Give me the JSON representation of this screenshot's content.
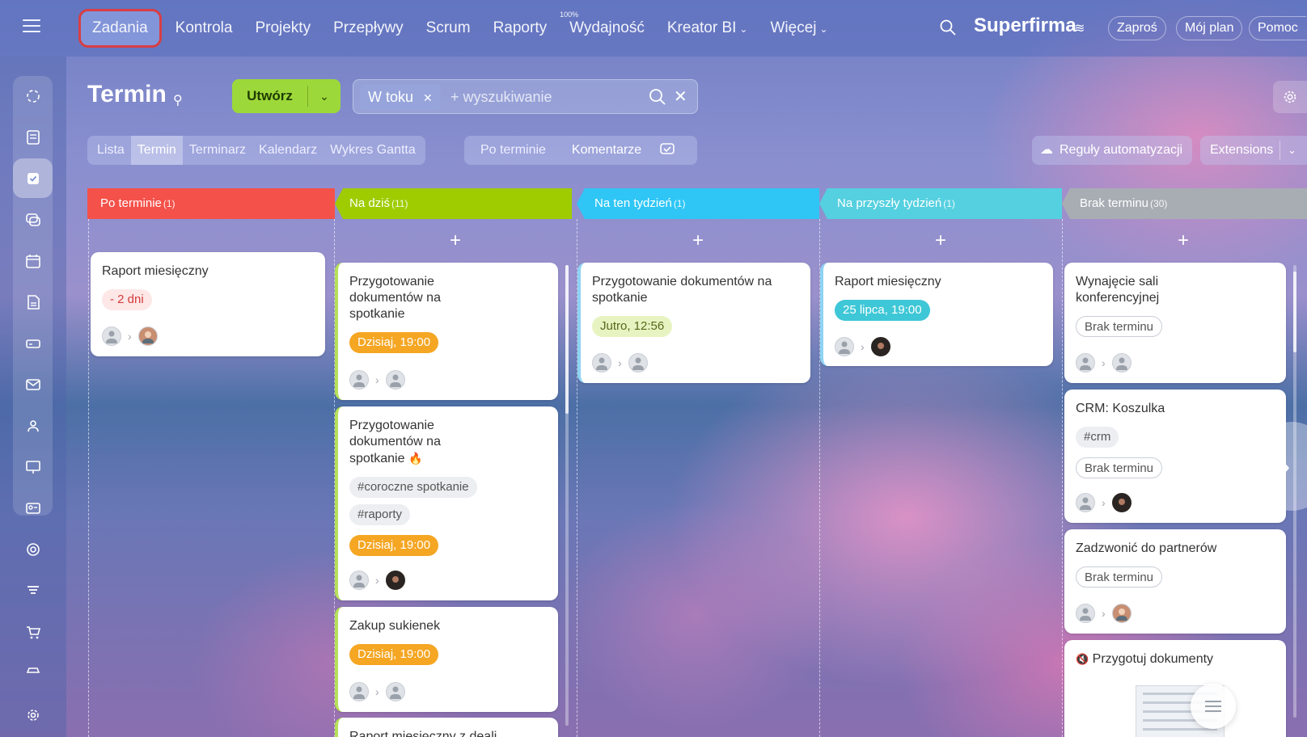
{
  "topbar": {
    "nav": [
      {
        "label": "Zadania",
        "active": true
      },
      {
        "label": "Kontrola"
      },
      {
        "label": "Projekty"
      },
      {
        "label": "Przepływy"
      },
      {
        "label": "Scrum"
      },
      {
        "label": "Raporty"
      },
      {
        "label": "Wydajność",
        "sup": "100%"
      },
      {
        "label": "Kreator BI",
        "dropdown": true
      },
      {
        "label": "Więcej",
        "dropdown": true
      }
    ],
    "brand": "Superfirma",
    "buttons": [
      "Zaproś",
      "Mój plan",
      "Pomoc"
    ]
  },
  "page": {
    "title": "Termin",
    "create_label": "Utwórz",
    "filter_chip": "W toku",
    "search_placeholder": "+ wyszukiwanie"
  },
  "view_tabs": [
    "Lista",
    "Termin",
    "Terminarz",
    "Kalendarz",
    "Wykres Gantta"
  ],
  "active_view": "Termin",
  "filter_tabs": [
    "Po terminie",
    "Komentarze"
  ],
  "automation_label": "Reguły automatyzacji",
  "extensions_label": "Extensions",
  "columns": [
    {
      "title": "Po terminie",
      "count": "(1)",
      "color": "#f4514a"
    },
    {
      "title": "Na dziś",
      "count": "(11)",
      "color": "#9ecc00"
    },
    {
      "title": "Na ten tydzień",
      "count": "(1)",
      "color": "#2fc6f6"
    },
    {
      "title": "Na przyszły tydzień",
      "count": "(1)",
      "color": "#55d0e0"
    },
    {
      "title": "Brak terminu",
      "count": "(30)",
      "color": "#a8adb4"
    }
  ],
  "cards": {
    "overdue": [
      {
        "title": "Raport miesięczny",
        "badge": "- 2 dni"
      }
    ],
    "today": [
      {
        "title": "Przygotowanie dokumentów na spotkanie",
        "badge": "Dzisiaj, 19:00"
      },
      {
        "title": "Przygotowanie dokumentów na spotkanie",
        "tags": [
          "#coroczne spotkanie",
          "#raporty"
        ],
        "badge": "Dzisiaj, 19:00"
      },
      {
        "title": "Zakup sukienek",
        "badge": "Dzisiaj, 19:00"
      },
      {
        "title": "Raport miesięczny z deali"
      }
    ],
    "week": [
      {
        "title": "Przygotowanie dokumentów na spotkanie",
        "badge": "Jutro, 12:56"
      }
    ],
    "next_week": [
      {
        "title": "Raport miesięczny",
        "badge": "25 lipca, 19:00"
      }
    ],
    "no_deadline": [
      {
        "title": "Wynajęcie sali konferencyjnej",
        "badge": "Brak terminu"
      },
      {
        "title": "CRM: Koszulka",
        "tags": [
          "#crm"
        ],
        "badge": "Brak terminu"
      },
      {
        "title": "Zadzwonić do partnerów",
        "badge": "Brak terminu"
      },
      {
        "title": "Przygotuj dokumenty"
      }
    ]
  },
  "colors": {
    "accent_green": "#9dd83a",
    "orange_badge": "#f5a623",
    "teal_badge": "#3ec7d6",
    "active_outline": "#e23a3a"
  }
}
